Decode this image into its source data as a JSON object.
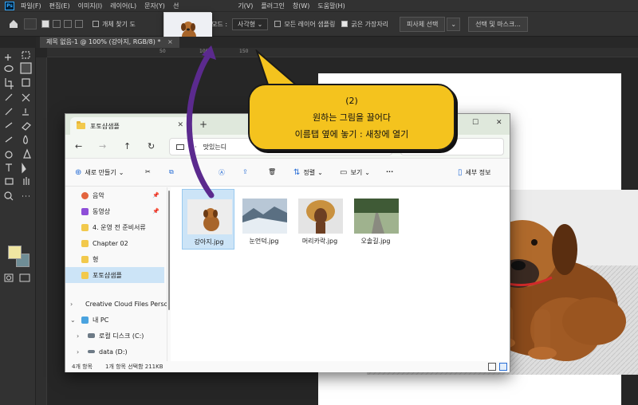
{
  "photoshop": {
    "menu": [
      "파일(F)",
      "편집(E)",
      "이미지(I)",
      "레이어(L)",
      "문자(Y)",
      "선"
    ],
    "menu_right": [
      "기(V)",
      "플러그인",
      "창(W)",
      "도움말(H)"
    ],
    "logo": "Ps",
    "options": {
      "auto_select_label": "개체 찾기 도",
      "mode_label": "모드 :",
      "mode_value": "사각형",
      "sample_all_layers": "모든 레이어 샘플링",
      "hard_edge": "굵은 가장자리",
      "select_subject": "피사체 선택",
      "select_and_mask": "선택 및 마스크..."
    },
    "document_tab": "제목 없음-1 @ 100% (강아지, RGB/8) *",
    "ruler_marks": [
      "50",
      "100",
      "150"
    ],
    "drag_plus": "+",
    "colors": {
      "foreground": "#f0e6a2",
      "background": "#6f8d96"
    }
  },
  "callout": {
    "step": "(2)",
    "line1": "원하는 그림을 끌어다",
    "line2": "이름탭 옆에 놓기 : 새창에 열기",
    "color": "#f4c31e"
  },
  "explorer": {
    "tab_title": "포토샵샘플",
    "new_tab": "+",
    "address_text": "맛있는디",
    "search_placeholder": "검색",
    "commands": {
      "new": "새로 만들기",
      "sort": "정렬",
      "view": "보기",
      "more": "···",
      "details": "세부 정보"
    },
    "sidebar": [
      {
        "label": "음악",
        "pinned": true,
        "color": "#e3643e"
      },
      {
        "label": "동영상",
        "pinned": true,
        "color": "#8e4fd8"
      },
      {
        "label": "4. 운영 전 준비서류",
        "pinned": false,
        "color": "#f2c94c"
      },
      {
        "label": "Chapter 02",
        "pinned": false,
        "color": "#f2c94c"
      },
      {
        "label": "형",
        "pinned": false,
        "color": "#f2c94c"
      },
      {
        "label": "포토샵샘플",
        "pinned": false,
        "color": "#f2c94c",
        "selected": true
      },
      {
        "label": "Creative Cloud Files Personal",
        "pinned": false,
        "color": "#f2c94c",
        "chevron": "›"
      },
      {
        "label": "내 PC",
        "pinned": false,
        "color": "#4aa3df",
        "chevron": "⌄"
      },
      {
        "label": "로컬 디스크 (C:)",
        "pinned": false,
        "color": "#6d7a86",
        "chevron": "›"
      },
      {
        "label": "data (D:)",
        "pinned": false,
        "color": "#6d7a86",
        "chevron": "›"
      }
    ],
    "files": [
      {
        "name": "강아지.jpg",
        "selected": true
      },
      {
        "name": "눈언덕.jpg",
        "selected": false
      },
      {
        "name": "머리카락.jpg",
        "selected": false
      },
      {
        "name": "오솔길.jpg",
        "selected": false
      }
    ],
    "status": {
      "count": "4개 항목",
      "selected": "1개 항목 선택함 211KB"
    }
  }
}
